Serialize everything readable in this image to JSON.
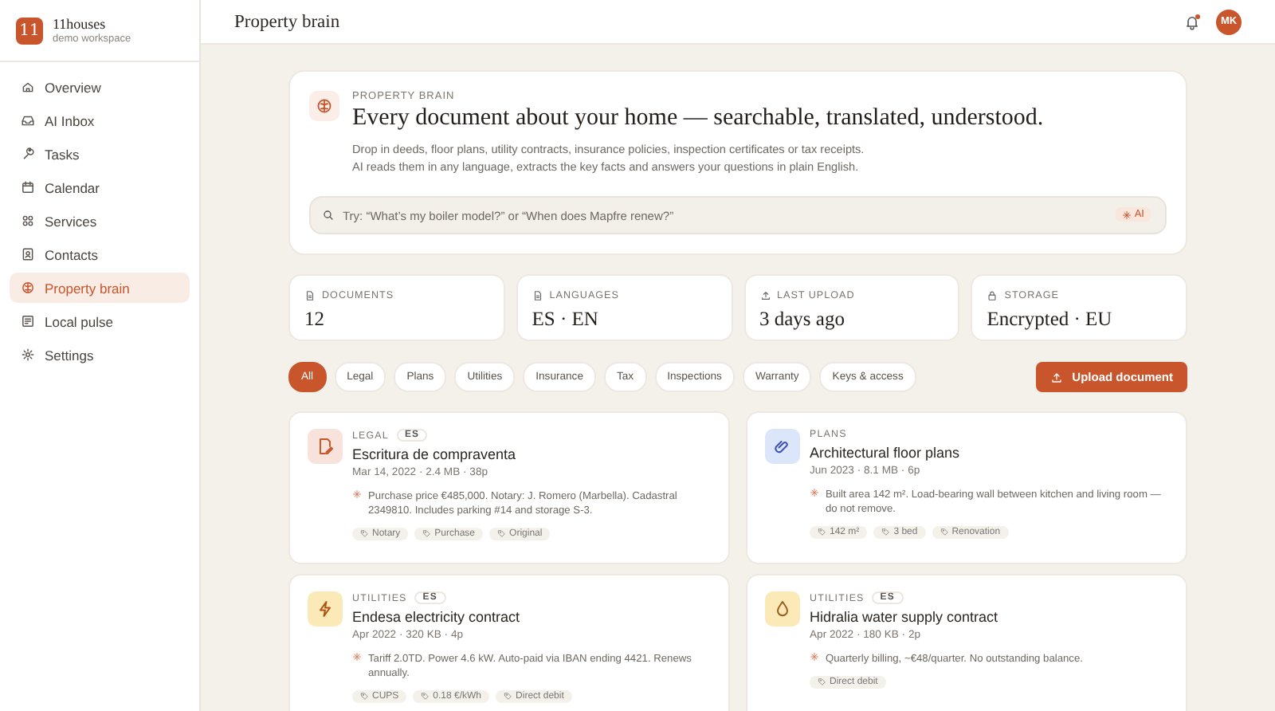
{
  "brand": {
    "initials": "11",
    "name": "11houses",
    "subtitle": "demo workspace"
  },
  "sidebar": {
    "items": [
      {
        "label": "Overview",
        "selected": false
      },
      {
        "label": "AI Inbox",
        "selected": false
      },
      {
        "label": "Tasks",
        "selected": false
      },
      {
        "label": "Calendar",
        "selected": false
      },
      {
        "label": "Services",
        "selected": false
      },
      {
        "label": "Contacts",
        "selected": false
      },
      {
        "label": "Property brain",
        "selected": true
      },
      {
        "label": "Local pulse",
        "selected": false
      },
      {
        "label": "Settings",
        "selected": false
      }
    ]
  },
  "header": {
    "title": "Property brain",
    "notifications_unread": true,
    "avatar": "MK"
  },
  "hero": {
    "eyebrow": "PROPERTY BRAIN",
    "heading": "Every document about your home — searchable, translated, understood.",
    "description": [
      "Drop in deeds, floor plans, utility contracts, insurance policies, inspection certificates or tax receipts.",
      "AI reads them in any language, extracts the key facts and answers your questions in plain English."
    ],
    "search": {
      "placeholder": "Try: “What’s my boiler model?” or “When does Mapfre renew?”",
      "badge": "AI"
    }
  },
  "stats": [
    {
      "label": "DOCUMENTS",
      "value": "12"
    },
    {
      "label": "LANGUAGES",
      "value": "ES · EN"
    },
    {
      "label": "LAST UPLOAD",
      "value": "3 days ago"
    },
    {
      "label": "STORAGE",
      "value": "Encrypted · EU"
    }
  ],
  "filters": [
    {
      "label": "All",
      "selected": true
    },
    {
      "label": "Legal",
      "selected": false
    },
    {
      "label": "Plans",
      "selected": false
    },
    {
      "label": "Utilities",
      "selected": false
    },
    {
      "label": "Insurance",
      "selected": false
    },
    {
      "label": "Tax",
      "selected": false
    },
    {
      "label": "Inspections",
      "selected": false
    },
    {
      "label": "Warranty",
      "selected": false
    },
    {
      "label": "Keys & access",
      "selected": false
    }
  ],
  "upload_button": "Upload document",
  "documents": [
    {
      "kind": "legal",
      "category": "LEGAL",
      "language": "ES",
      "title": "Escritura de compraventa",
      "meta": "Mar 14, 2022 · 2.4 MB · 38p",
      "summary": "Purchase price €485,000. Notary: J. Romero (Marbella). Cadastral 2349810. Includes parking #14 and storage S-3.",
      "tags": [
        "Notary",
        "Purchase",
        "Original"
      ]
    },
    {
      "kind": "plans",
      "category": "PLANS",
      "title": "Architectural floor plans",
      "meta": "Jun 2023 · 8.1 MB · 6p",
      "summary": "Built area 142 m². Load-bearing wall between kitchen and living room — do not remove.",
      "tags": [
        "142 m²",
        "3 bed",
        "Renovation"
      ]
    },
    {
      "kind": "electricity",
      "category": "UTILITIES",
      "language": "ES",
      "title": "Endesa electricity contract",
      "meta": "Apr 2022 · 320 KB · 4p",
      "summary": "Tariff 2.0TD. Power 4.6 kW. Auto-paid via IBAN ending 4421. Renews annually.",
      "tags": [
        "CUPS",
        "0.18 €/kWh",
        "Direct debit"
      ]
    },
    {
      "kind": "water",
      "category": "UTILITIES",
      "language": "ES",
      "title": "Hidralia water supply contract",
      "meta": "Apr 2022 · 180 KB · 2p",
      "summary": "Quarterly billing, ~€48/quarter. No outstanding balance.",
      "tags": [
        "Direct debit"
      ]
    }
  ]
}
